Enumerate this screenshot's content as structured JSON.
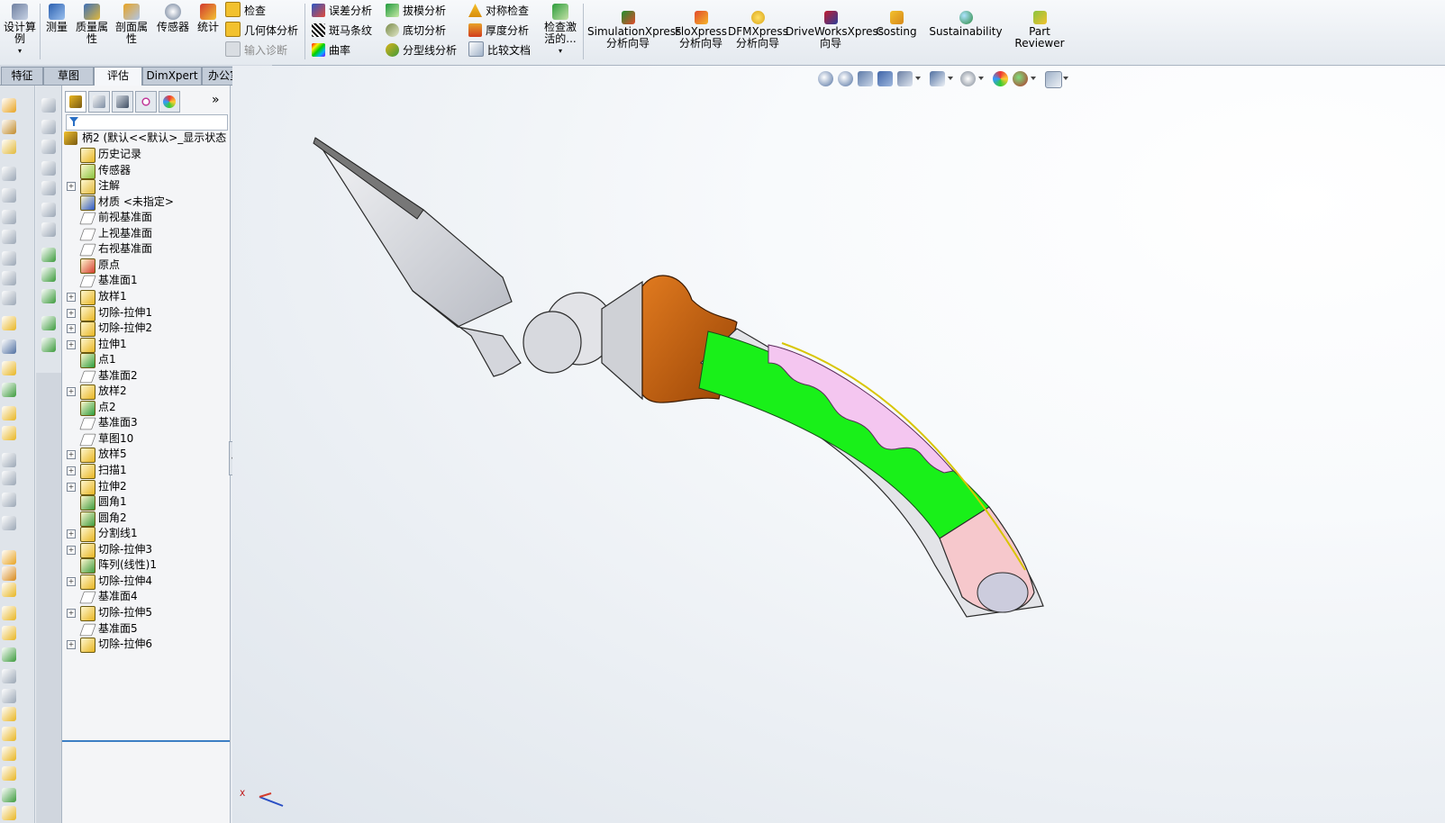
{
  "ribbon": {
    "design_study": "设计算例",
    "measure": "测量",
    "mass_props": "质量属性",
    "section_props": "剖面属性",
    "sensors": "传感器",
    "statistics": "统计",
    "check": "检查",
    "geometry_analysis": "几何体分析",
    "import_diagnostics": "输入诊断",
    "deviation_analysis": "误差分析",
    "zebra_stripes": "斑马条纹",
    "curvature": "曲率",
    "draft_analysis": "拔模分析",
    "undercut_analysis": "底切分析",
    "parting_line_analysis": "分型线分析",
    "symmetry_check": "对称检查",
    "thickness_analysis": "厚度分析",
    "compare_documents": "比较文档",
    "check_active": "检查激活的...",
    "simulation_xpress": "SimulationXpress",
    "simulation_xpress_sub": "分析向导",
    "flo_xpress": "FloXpress",
    "flo_xpress_sub": "分析向导",
    "dfm_xpress": "DFMXpress",
    "dfm_xpress_sub": "分析向导",
    "driveworks_xpress": "DriveWorksXpress",
    "driveworks_xpress_sub": "向导",
    "costing": "Costing",
    "sustainability": "Sustainability",
    "part_reviewer": "Part",
    "part_reviewer_sub": "Reviewer"
  },
  "tabs": [
    "特征",
    "草图",
    "评估",
    "DimXpert",
    "办公室产品"
  ],
  "active_tab": "评估",
  "tree": {
    "root": "柄2 (默认<<默认>_显示状态",
    "items": [
      {
        "label": "历史记录"
      },
      {
        "label": "传感器"
      },
      {
        "label": "注解"
      },
      {
        "label": "材质 <未指定>"
      },
      {
        "label": "前视基准面"
      },
      {
        "label": "上视基准面"
      },
      {
        "label": "右视基准面"
      },
      {
        "label": "原点"
      },
      {
        "label": "基准面1"
      },
      {
        "label": "放样1"
      },
      {
        "label": "切除-拉伸1"
      },
      {
        "label": "切除-拉伸2"
      },
      {
        "label": "拉伸1"
      },
      {
        "label": "点1"
      },
      {
        "label": "基准面2"
      },
      {
        "label": "放样2"
      },
      {
        "label": "点2"
      },
      {
        "label": "基准面3"
      },
      {
        "label": "草图10"
      },
      {
        "label": "放样5"
      },
      {
        "label": "扫描1"
      },
      {
        "label": "拉伸2"
      },
      {
        "label": "圆角1"
      },
      {
        "label": "圆角2"
      },
      {
        "label": "分割线1"
      },
      {
        "label": "切除-拉伸3"
      },
      {
        "label": "阵列(线性)1"
      },
      {
        "label": "切除-拉伸4"
      },
      {
        "label": "基准面4"
      },
      {
        "label": "切除-拉伸5"
      },
      {
        "label": "基准面5"
      },
      {
        "label": "切除-拉伸6"
      }
    ]
  },
  "triad_label": "X",
  "colors": {
    "handle_green": "#19f019",
    "handle_pink": "#f4c6f0",
    "handle_end": "#f6c8cc",
    "collar_orange": "#c45a0c",
    "metal": "#d9dbe0"
  }
}
